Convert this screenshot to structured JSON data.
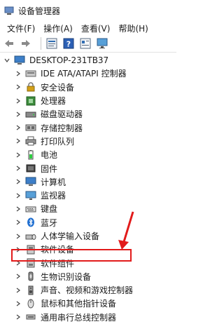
{
  "window": {
    "title": "设备管理器"
  },
  "menu": [
    "文件(F)",
    "操作(A)",
    "查看(V)",
    "帮助(H)"
  ],
  "toolbar": [
    "back-icon",
    "forward-icon",
    "properties-icon",
    "help-icon",
    "view-icon",
    "monitor-icon"
  ],
  "tree": {
    "root": "DESKTOP-231TB37",
    "items": [
      {
        "label": "IDE ATA/ATAPI 控制器",
        "icon": "ide-icon"
      },
      {
        "label": "安全设备",
        "icon": "security-icon"
      },
      {
        "label": "处理器",
        "icon": "cpu-icon"
      },
      {
        "label": "磁盘驱动器",
        "icon": "disk-icon"
      },
      {
        "label": "存储控制器",
        "icon": "storage-icon"
      },
      {
        "label": "打印队列",
        "icon": "printer-icon"
      },
      {
        "label": "电池",
        "icon": "battery-icon"
      },
      {
        "label": "固件",
        "icon": "firmware-icon"
      },
      {
        "label": "计算机",
        "icon": "computer-icon"
      },
      {
        "label": "监视器",
        "icon": "monitor-icon"
      },
      {
        "label": "键盘",
        "icon": "keyboard-icon"
      },
      {
        "label": "蓝牙",
        "icon": "bluetooth-icon"
      },
      {
        "label": "人体学输入设备",
        "icon": "hid-icon"
      },
      {
        "label": "软件设备",
        "icon": "software-device-icon"
      },
      {
        "label": "软件组件",
        "icon": "software-component-icon"
      },
      {
        "label": "生物识别设备",
        "icon": "biometric-icon"
      },
      {
        "label": "声音、视频和游戏控制器",
        "icon": "audio-icon"
      },
      {
        "label": "鼠标和其他指针设备",
        "icon": "mouse-icon"
      },
      {
        "label": "通用串行总线控制器",
        "icon": "usb-icon"
      }
    ]
  },
  "annotation": {
    "color": "#e21b1b"
  }
}
